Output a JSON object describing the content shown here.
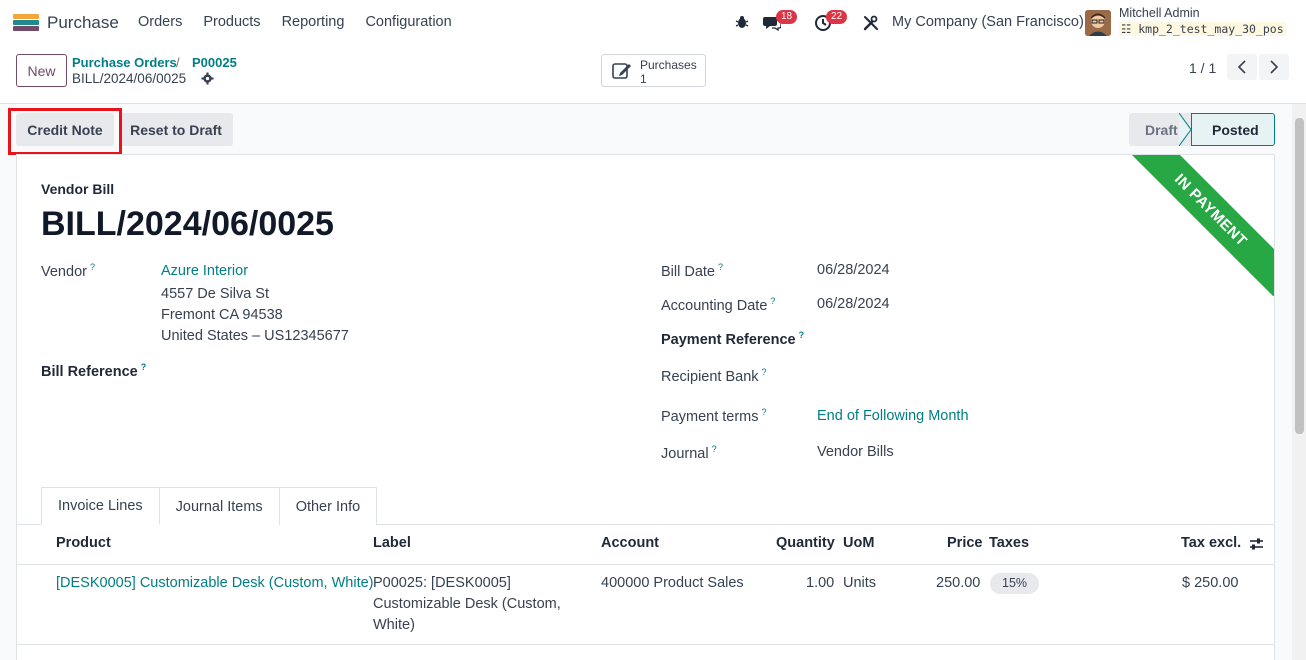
{
  "navbar": {
    "app_name": "Purchase",
    "menu": [
      "Orders",
      "Products",
      "Reporting",
      "Configuration"
    ],
    "chat_count": "18",
    "activity_count": "22",
    "company": "My Company (San Francisco)",
    "user_name": "Mitchell Admin",
    "db_name": "kmp_2_test_may_30_pos"
  },
  "control": {
    "new_label": "New",
    "breadcrumb_parent": "Purchase Orders",
    "breadcrumb_sep": "/",
    "breadcrumb_order": "P00025",
    "breadcrumb_current": "BILL/2024/06/0025",
    "smart_label": "Purchases",
    "smart_count": "1",
    "pager": "1 / 1"
  },
  "actions": {
    "credit_note": "Credit Note",
    "reset_to_draft": "Reset to Draft"
  },
  "status": {
    "draft": "Draft",
    "posted": "Posted",
    "ribbon": "IN PAYMENT"
  },
  "form": {
    "doc_type": "Vendor Bill",
    "doc_name": "BILL/2024/06/0025",
    "vendor_label": "Vendor",
    "vendor_name": "Azure Interior",
    "vendor_addr1": "4557 De Silva St",
    "vendor_addr2": "Fremont CA 94538",
    "vendor_addr3": "United States – US12345677",
    "bill_reference_label": "Bill Reference",
    "bill_date_label": "Bill Date",
    "bill_date": "06/28/2024",
    "accounting_date_label": "Accounting Date",
    "accounting_date": "06/28/2024",
    "payment_reference_label": "Payment Reference",
    "recipient_bank_label": "Recipient Bank",
    "payment_terms_label": "Payment terms",
    "payment_terms": "End of Following Month",
    "journal_label": "Journal",
    "journal": "Vendor Bills",
    "help": "?"
  },
  "tabs": [
    "Invoice Lines",
    "Journal Items",
    "Other Info"
  ],
  "table": {
    "headers": {
      "product": "Product",
      "label": "Label",
      "account": "Account",
      "quantity": "Quantity",
      "uom": "UoM",
      "price": "Price",
      "taxes": "Taxes",
      "tax_excl": "Tax excl."
    },
    "rows": [
      {
        "product": "[DESK0005] Customizable Desk (Custom, White)",
        "label_1": "P00025: [DESK0005]",
        "label_2": "Customizable Desk (Custom,",
        "label_3": "White)",
        "account": "400000 Product Sales",
        "quantity": "1.00",
        "uom": "Units",
        "price": "250.00",
        "tax": "15%",
        "tax_excl": "$ 250.00"
      }
    ]
  },
  "colors": {
    "brand": "#714b67",
    "link": "#017e84",
    "ribbon": "#28a745",
    "badge": "#dc3545",
    "highlight": "#e8141b"
  }
}
